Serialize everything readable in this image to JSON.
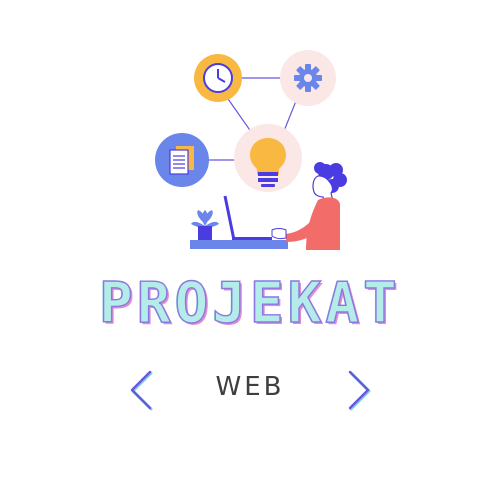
{
  "brand": {
    "title": "PROJEKAT",
    "subtitle": "WEB"
  },
  "icons": {
    "clock": "clock-icon",
    "gear": "gear-icon",
    "documents": "documents-icon",
    "lightbulb": "lightbulb-icon",
    "plant": "plant-icon",
    "laptop": "laptop-icon",
    "person": "person-illustration",
    "arrow_left": "chevron-left-icon",
    "arrow_right": "chevron-right-icon"
  },
  "colors": {
    "clock_bg": "#f8b841",
    "gear_bg": "#fbe8e6",
    "documents_bg": "#6a86ea",
    "bulb_bg": "#fbe8e6",
    "bulb": "#f8b841",
    "accent_blue": "#4a3ce0",
    "person_shirt": "#f26c6a",
    "title_fill": "#b4ece9",
    "title_stroke": "#8a78e0",
    "arrow_color": "#6a56e0"
  }
}
